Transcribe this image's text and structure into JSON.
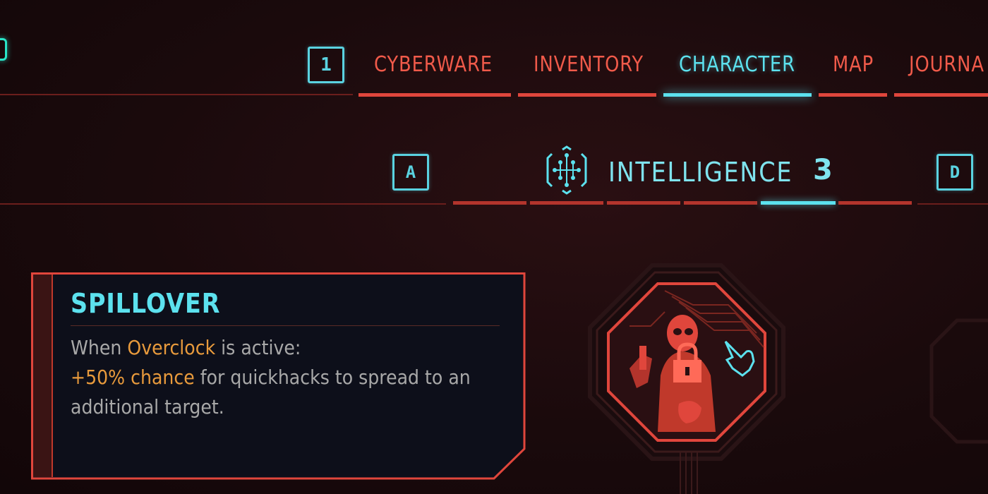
{
  "top_nav": {
    "tab_switch_key": "1",
    "tabs": [
      {
        "label": "CYBERWARE",
        "active": false
      },
      {
        "label": "INVENTORY",
        "active": false
      },
      {
        "label": "CHARACTER",
        "active": true
      },
      {
        "label": "MAP",
        "active": false
      },
      {
        "label": "JOURNA",
        "active": false
      }
    ]
  },
  "attribute": {
    "prev_key": "A",
    "next_key": "D",
    "name": "INTELLIGENCE",
    "level": "3",
    "icon": "intelligence-circuit-icon",
    "segments": 6,
    "active_segment": 4
  },
  "perk": {
    "name": "SPILLOVER",
    "description": {
      "line1_prefix": "When ",
      "line1_highlight": "Overclock",
      "line1_suffix": " is active:",
      "line2_highlight": "+50% chance",
      "line2_suffix": " for quickhacks to spread to an",
      "line3": "additional target."
    },
    "node_icon": "netrunner-portrait-icon",
    "locked": true,
    "lock_icon": "padlock-icon",
    "cursor_icon": "pointer-hand-icon"
  },
  "colors": {
    "accent_cyan": "#5ce1ee",
    "accent_red": "#e0463c",
    "highlight_orange": "#e89a3c",
    "background": "#1a0a0c"
  }
}
